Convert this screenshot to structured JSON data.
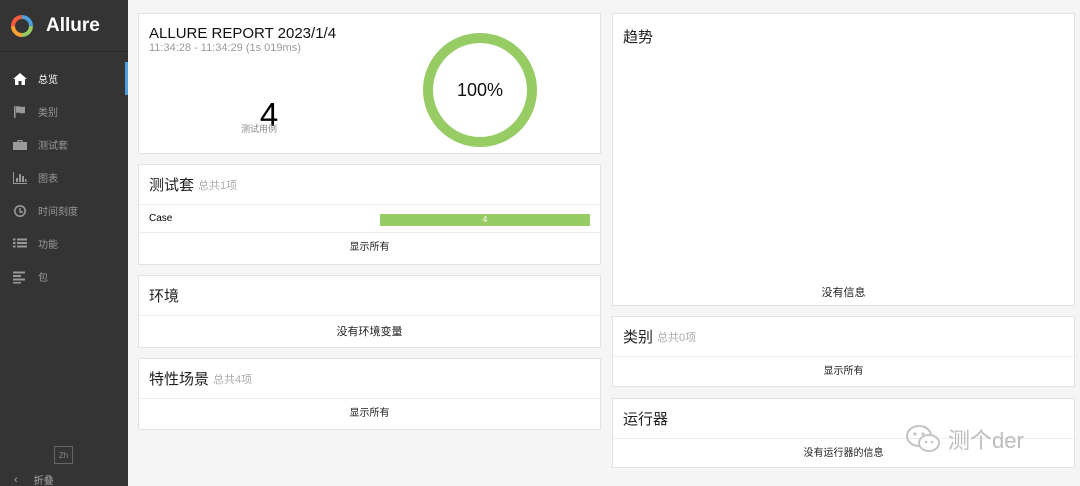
{
  "app": {
    "name": "Allure"
  },
  "sidebar": {
    "items": [
      {
        "label": "总览",
        "icon": "home-icon",
        "active": true
      },
      {
        "label": "类别",
        "icon": "flag-icon",
        "active": false
      },
      {
        "label": "测试套",
        "icon": "briefcase-icon",
        "active": false
      },
      {
        "label": "图表",
        "icon": "bar-chart-icon",
        "active": false
      },
      {
        "label": "时间刻度",
        "icon": "clock-icon",
        "active": false
      },
      {
        "label": "功能",
        "icon": "list-icon",
        "active": false
      },
      {
        "label": "包",
        "icon": "align-left-icon",
        "active": false
      }
    ],
    "lang_button": "Zh",
    "collapse_label": "折叠"
  },
  "summary": {
    "title": "ALLURE REPORT 2023/1/4",
    "time": "11:34:28 - 11:34:29 (1s 019ms)",
    "count": "4",
    "count_label": "测试用例",
    "percent_label": "100%",
    "percent": 100
  },
  "suites": {
    "title": "测试套",
    "subtitle": "总共1项",
    "rows": [
      {
        "name": "Case",
        "count": "4"
      }
    ],
    "show_all": "显示所有"
  },
  "environment": {
    "title": "环境",
    "empty": "没有环境变量"
  },
  "features": {
    "title": "特性场景",
    "subtitle": "总共4项",
    "show_all": "显示所有"
  },
  "trend": {
    "title": "趋势",
    "empty": "没有信息"
  },
  "categories": {
    "title": "类别",
    "subtitle": "总共0项",
    "show_all": "显示所有"
  },
  "executors": {
    "title": "运行器",
    "empty": "没有运行器的信息"
  },
  "watermark": {
    "text": "测个der"
  },
  "colors": {
    "passed": "#97cc64",
    "sidebar": "#343434",
    "accent": "#4da0dd"
  }
}
